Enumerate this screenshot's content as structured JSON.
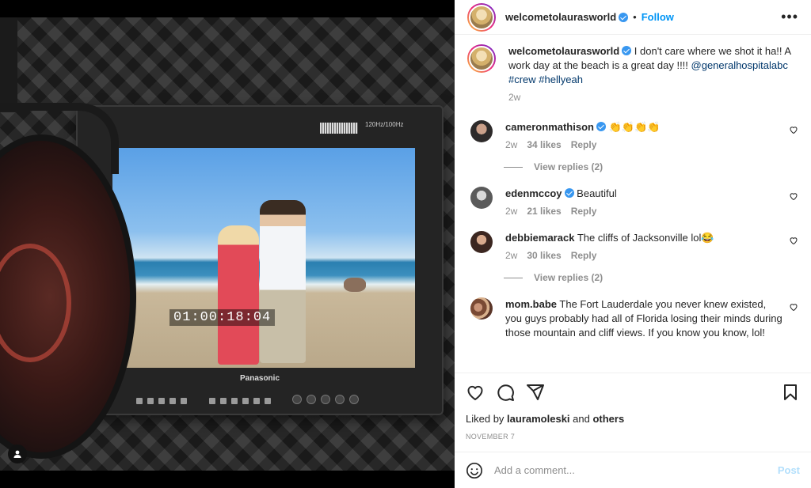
{
  "post": {
    "author": "welcometolaurasworld",
    "follow_label": "Follow",
    "dot": "•",
    "more_label": "•••",
    "caption_text": "I don't care where we shot it ha!! A work day at the beach is a great day !!!! ",
    "caption_mention": "@generalhospitalabc",
    "caption_tags": "#crew #hellyeah",
    "caption_age": "2w",
    "timecode": "01:00:18:04",
    "monitor_brand": "Panasonic",
    "monitor_refresh": "120Hz/100Hz"
  },
  "comments": [
    {
      "user": "cameronmathison",
      "verified": true,
      "text": "👏👏👏👏",
      "age": "2w",
      "likes": "34 likes",
      "reply": "Reply",
      "view_replies": "View replies (2)"
    },
    {
      "user": "edenmccoy",
      "verified": true,
      "text": "Beautiful",
      "age": "2w",
      "likes": "21 likes",
      "reply": "Reply"
    },
    {
      "user": "debbiemarack",
      "verified": false,
      "text": "The cliffs of Jacksonville lol😂",
      "age": "2w",
      "likes": "30 likes",
      "reply": "Reply",
      "view_replies": "View replies (2)"
    },
    {
      "user": "mom.babe",
      "verified": false,
      "text": "The Fort Lauderdale you never knew existed, you guys probably had all of Florida losing their minds during those mountain and cliff views. If you know you know, lol!"
    }
  ],
  "actions": {
    "liked_prefix": "Liked by ",
    "liked_user": "lauramoleski",
    "liked_and": " and ",
    "liked_others": "others",
    "date": "November 7",
    "add_comment_placeholder": "Add a comment...",
    "post_label": "Post"
  },
  "colors": {
    "accent": "#0095f6",
    "link": "#00376b",
    "muted": "#8e8e8e",
    "verified": "#3897f0"
  }
}
